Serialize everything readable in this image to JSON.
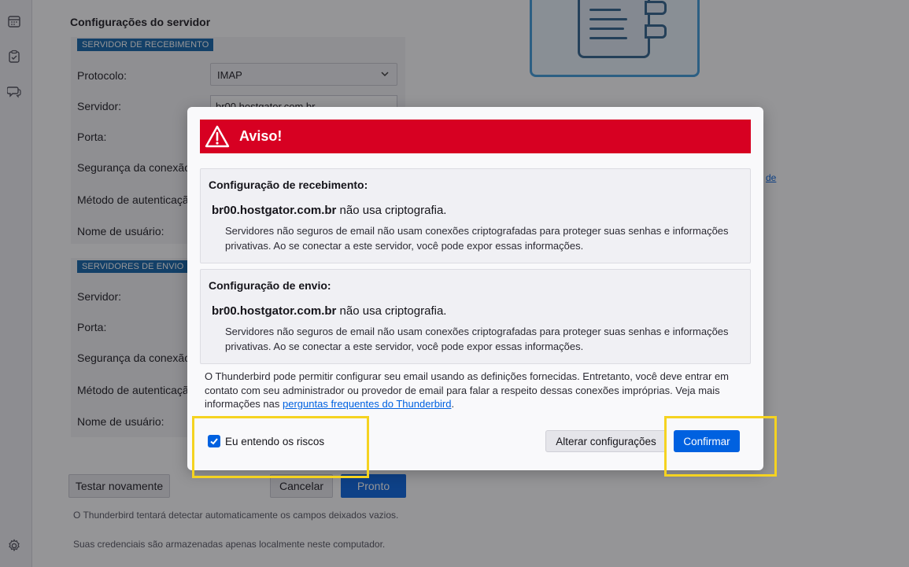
{
  "server_settings": {
    "title": "Configurações do servidor",
    "incoming_badge": "SERVIDOR DE RECEBIMENTO",
    "incoming_labels": [
      "Protocolo:",
      "Servidor:",
      "Porta:",
      "Segurança da conexão:",
      "Método de autenticação:",
      "Nome de usuário:"
    ],
    "protocol_value": "IMAP",
    "server_value": "br00.hostgator.com.br",
    "outgoing_badge": "SERVIDORES DE ENVIO",
    "outgoing_labels": [
      "Servidor:",
      "Porta:",
      "Segurança da conexão:",
      "Método de autenticação:",
      "Nome de usuário:"
    ]
  },
  "bottom_buttons": {
    "retest": "Testar novamente",
    "cancel": "Cancelar",
    "done": "Pronto"
  },
  "notes": {
    "auto_detect": "O Thunderbird tentará detectar automaticamente os campos deixados vazios.",
    "credentials": "Suas credenciais são armazenadas apenas localmente neste computador."
  },
  "side_link": "de",
  "dialog": {
    "title": "Aviso!",
    "incoming": {
      "heading": "Configuração de recebimento:",
      "host": "br00.hostgator.com.br",
      "host_suffix": "não usa criptografia.",
      "description": "Servidores não seguros de email não usam conexões criptografadas para proteger suas senhas e informações privativas. Ao se conectar a este servidor, você pode expor essas informações."
    },
    "outgoing": {
      "heading": "Configuração de envio:",
      "host": "br00.hostgator.com.br",
      "host_suffix": "não usa criptografia.",
      "description": "Servidores não seguros de email não usam conexões criptografadas para proteger suas senhas e informações privativas. Ao se conectar a este servidor, você pode expor essas informações."
    },
    "footer_text": "O Thunderbird pode permitir configurar seu email usando as definições fornecidas. Entretanto, você deve entrar em contato com seu administrador ou provedor de email para falar a respeito dessas conexões impróprias. Veja mais informações nas",
    "footer_link": "perguntas frequentes do Thunderbird",
    "footer_end": ".",
    "checkbox_label": "Eu entendo os riscos",
    "checkbox_checked": true,
    "change_button": "Alterar configurações",
    "confirm_button": "Confirmar"
  },
  "colors": {
    "banner": "#d70022",
    "accent": "#0061e0",
    "highlight": "#f5d320"
  },
  "icons": [
    "calendar-icon",
    "tasks-icon",
    "chat-icon",
    "settings-icon",
    "warning-icon",
    "checkmark-icon",
    "chevron-down-icon"
  ]
}
